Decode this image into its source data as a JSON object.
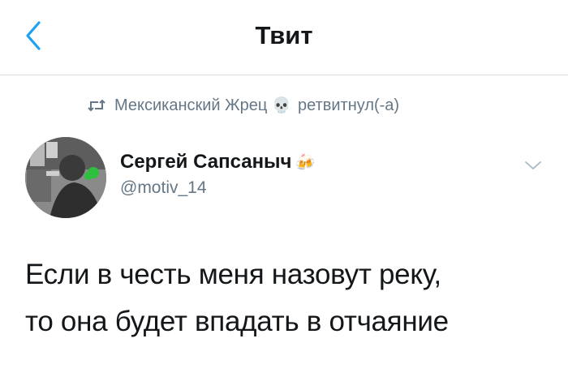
{
  "header": {
    "title": "Твит",
    "back_icon": "chevron-left-icon"
  },
  "retweet": {
    "icon": "retweet-icon",
    "retweeter_name": "Мексиканский Жрец",
    "emoji": "💀",
    "action_text": "ретвитнул(-а)"
  },
  "tweet": {
    "author_name": "Сергей Сапсаныч",
    "author_emoji": "🍻",
    "author_handle": "@motiv_14",
    "text_lines": [
      "Если в честь меня назовут реку,",
      "то она будет впадать в отчаяние"
    ],
    "menu_icon": "chevron-down-icon"
  },
  "colors": {
    "accent": "#1da1f2",
    "secondary_text": "#657786",
    "primary_text": "#14171a",
    "divider": "#dcdcdc"
  }
}
